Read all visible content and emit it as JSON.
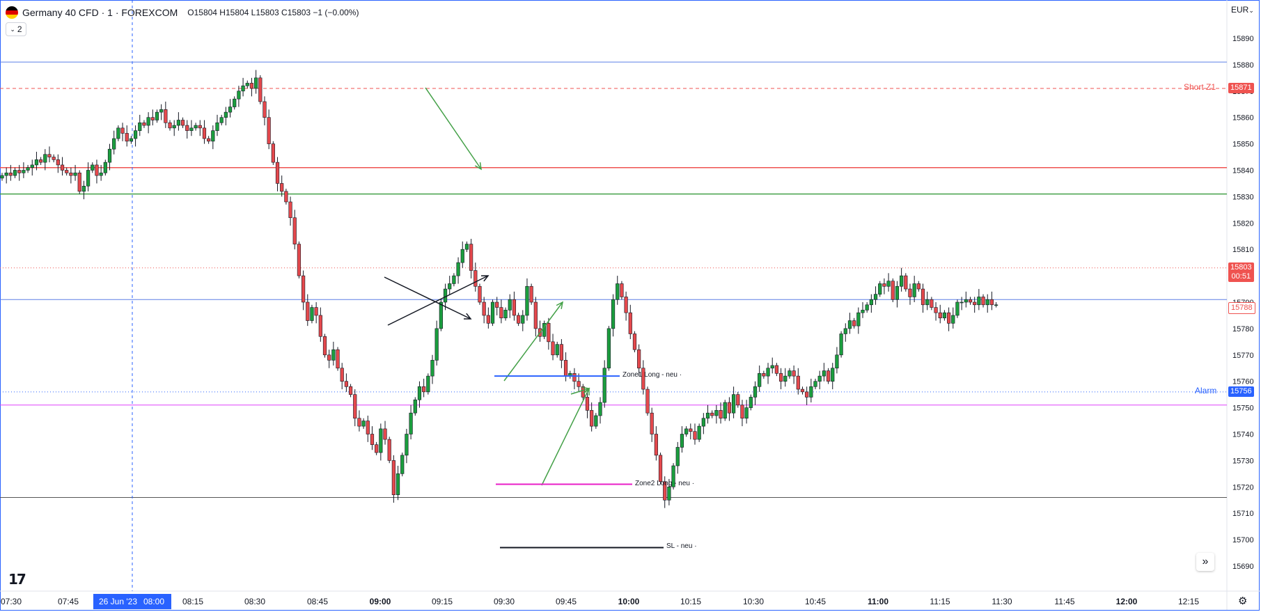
{
  "header": {
    "symbol": "Germany 40 CFD · 1 · FOREXCOM",
    "ohlc": "O15804 H15804 L15803 C15803 −1 (−0.00%)",
    "legend_toggle": "2",
    "currency": "EUR"
  },
  "colors": {
    "up": "#26a69a",
    "down": "#ef5350",
    "body_up": "#1b9e3e",
    "body_down": "#e5494d",
    "accent_blue": "#2962ff"
  },
  "chart_data": {
    "type": "candlestick",
    "ylim": [
      15685,
      15900
    ],
    "y_ticks": [
      15690,
      15700,
      15710,
      15720,
      15730,
      15740,
      15750,
      15760,
      15770,
      15780,
      15790,
      15800,
      15810,
      15820,
      15830,
      15840,
      15850,
      15860,
      15870,
      15880,
      15890
    ],
    "x_ticks": [
      "07:30",
      "07:45",
      "26 Jun '23",
      "08:00",
      "08:15",
      "08:30",
      "08:45",
      "09:00",
      "09:15",
      "09:30",
      "09:45",
      "10:00",
      "10:15",
      "10:30",
      "10:45",
      "11:00",
      "11:15",
      "11:30",
      "11:45",
      "12:00",
      "12:15"
    ],
    "closes": [
      15838,
      15839,
      15838,
      15840,
      15839,
      15840,
      15841,
      15842,
      15844,
      15843,
      15846,
      15845,
      15844,
      15842,
      15840,
      15839,
      15838,
      15839,
      15832,
      15834,
      15840,
      15842,
      15838,
      15839,
      15843,
      15848,
      15852,
      15856,
      15854,
      15851,
      15852,
      15855,
      15858,
      15857,
      15860,
      15859,
      15862,
      15863,
      15858,
      15856,
      15857,
      15859,
      15857,
      15855,
      15856,
      15857,
      15856,
      15852,
      15851,
      15855,
      15858,
      15860,
      15862,
      15864,
      15867,
      15870,
      15872,
      15873,
      15871,
      15875,
      15866,
      15860,
      15850,
      15843,
      15835,
      15832,
      15828,
      15822,
      15812,
      15800,
      15790,
      15783,
      15788,
      15785,
      15777,
      15770,
      15768,
      15772,
      15765,
      15760,
      15758,
      15755,
      15746,
      15743,
      15745,
      15740,
      15736,
      15733,
      15742,
      15738,
      15730,
      15717,
      15725,
      15732,
      15740,
      15748,
      15753,
      15758,
      15756,
      15762,
      15768,
      15780,
      15790,
      15795,
      15797,
      15800,
      15805,
      15810,
      15812,
      15802,
      15796,
      15790,
      15785,
      15782,
      15790,
      15788,
      15784,
      15787,
      15791,
      15785,
      15782,
      15785,
      15796,
      15790,
      15780,
      15777,
      15782,
      15775,
      15770,
      15774,
      15768,
      15762,
      15763,
      15760,
      15758,
      15754,
      15749,
      15743,
      15747,
      15752,
      15765,
      15780,
      15791,
      15797,
      15792,
      15786,
      15778,
      15772,
      15765,
      15757,
      15748,
      15740,
      15732,
      15722,
      15715,
      15720,
      15728,
      15735,
      15740,
      15742,
      15741,
      15738,
      15743,
      15746,
      15748,
      15747,
      15749,
      15746,
      15752,
      15748,
      15755,
      15751,
      15746,
      15750,
      15754,
      15758,
      15763,
      15762,
      15765,
      15766,
      15763,
      15760,
      15762,
      15764,
      15762,
      15757,
      15756,
      15754,
      15758,
      15760,
      15762,
      15764,
      15760,
      15765,
      15770,
      15778,
      15780,
      15783,
      15781,
      15786,
      15787,
      15789,
      15791,
      15793,
      15797,
      15796,
      15798,
      15791,
      15796,
      15800,
      15795,
      15792,
      15797,
      15795,
      15789,
      15791,
      15788,
      15786,
      15784,
      15786,
      15782,
      15785,
      15790,
      15790,
      15791,
      15790,
      15789,
      15792,
      15789,
      15791,
      15789,
      15789
    ]
  },
  "levels": {
    "short_label": "Short Z1",
    "short_price": "15871",
    "alarm_label": "Alarm",
    "alarm_price": "15756",
    "last_price": "15803",
    "countdown": "00:51",
    "line_price": "15788",
    "zone1": "Zone1 Long - neu ·",
    "zone2": "Zone2 Long - neu ·",
    "sl": "SL - neu ·"
  },
  "time_highlight": {
    "date": "26 Jun '23",
    "time": "08:00"
  },
  "logo": "17"
}
